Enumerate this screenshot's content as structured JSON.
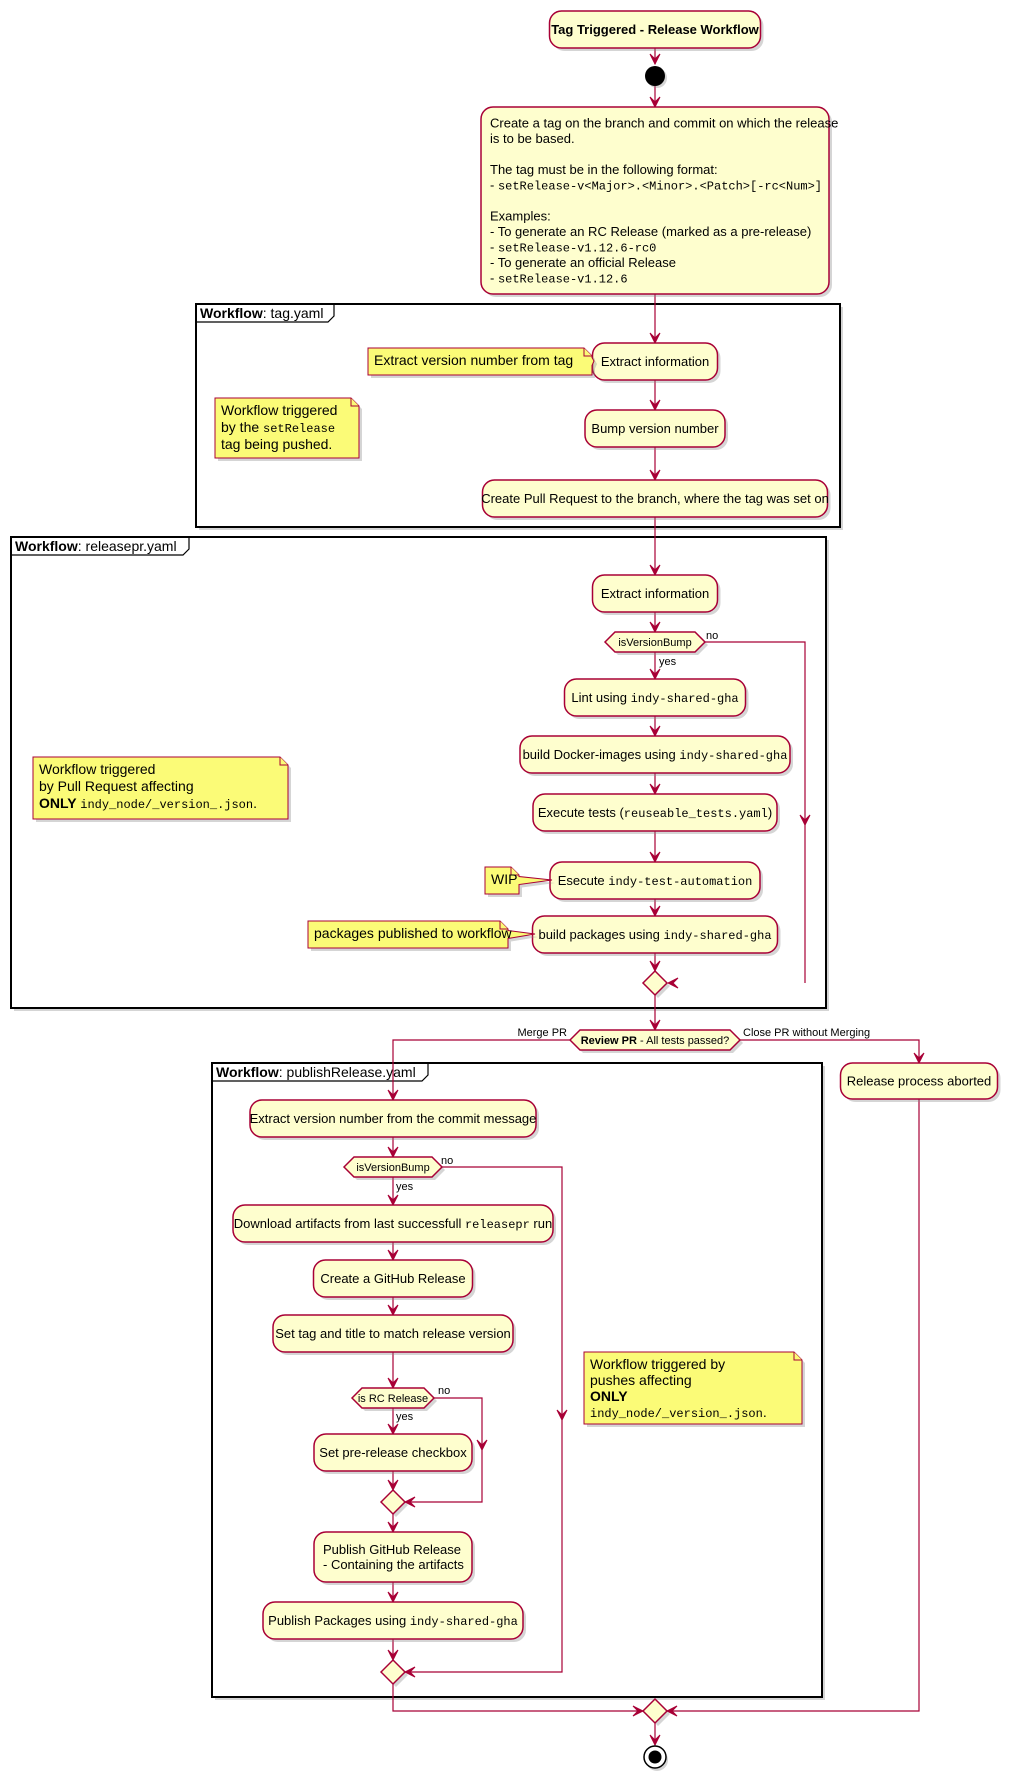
{
  "diagram": {
    "title": "Tag Triggered - Release Workflow",
    "intro": {
      "lines": [
        [
          {
            "t": "Create a tag on the branch and commit on which the release"
          }
        ],
        [
          {
            "t": "is to be based."
          }
        ],
        [],
        [
          {
            "t": "The tag must be in the following format:"
          }
        ],
        [
          {
            "t": " - "
          },
          {
            "t": "setRelease-v<Major>.<Minor>.<Patch>[-rc<Num>]",
            "mono": true
          }
        ],
        [],
        [
          {
            "t": "Examples:"
          }
        ],
        [
          {
            "t": "  - To generate an RC Release (marked as a pre-release)"
          }
        ],
        [
          {
            "t": "  - "
          },
          {
            "t": "setRelease-v1.12.6-rc0",
            "mono": true
          }
        ],
        [
          {
            "t": "  - To generate an official Release"
          }
        ],
        [
          {
            "t": "   - "
          },
          {
            "t": "setRelease-v1.12.6",
            "mono": true
          }
        ]
      ]
    },
    "frames": {
      "tag": {
        "keyword": "Workflow",
        "name": ": tag.yaml"
      },
      "releasepr": {
        "keyword": "Workflow",
        "name": ": releasepr.yaml"
      },
      "publish": {
        "keyword": "Workflow",
        "name": ": publishRelease.yaml"
      }
    },
    "tag_flow": {
      "extract": "Extract information",
      "extract_note": "Extract version number from tag",
      "bump": "Bump version number",
      "create_pr": "Create Pull Request to the branch, where the tag was set on",
      "trigger_note": [
        [
          {
            "t": "Workflow triggered"
          }
        ],
        [
          {
            "t": "by the "
          },
          {
            "t": "setRelease",
            "mono": true
          }
        ],
        [
          {
            "t": "tag being pushed."
          }
        ]
      ]
    },
    "releasepr_flow": {
      "extract": "Extract information",
      "decision": "isVersionBump",
      "yes": "yes",
      "no": "no",
      "lint": [
        {
          "t": "Lint using "
        },
        {
          "t": "indy-shared-gha",
          "mono": true
        }
      ],
      "docker": [
        {
          "t": "build Docker-images using "
        },
        {
          "t": "indy-shared-gha",
          "mono": true
        }
      ],
      "tests": [
        {
          "t": "Execute tests ("
        },
        {
          "t": "reuseable_tests.yaml",
          "mono": true
        },
        {
          "t": ")"
        }
      ],
      "automation": [
        {
          "t": "Esecute "
        },
        {
          "t": "indy-test-automation",
          "mono": true
        }
      ],
      "automation_note": "WIP",
      "packages": [
        {
          "t": "build packages using "
        },
        {
          "t": "indy-shared-gha",
          "mono": true
        }
      ],
      "packages_note": "packages published to workflow",
      "trigger_note": [
        [
          {
            "t": "Workflow triggered"
          }
        ],
        [
          {
            "t": "by Pull Request affecting"
          }
        ],
        [
          {
            "t": "ONLY ",
            "bold": true
          },
          {
            "t": "indy_node/_version_.json",
            "mono": true
          },
          {
            "t": "."
          }
        ]
      ]
    },
    "review": {
      "bold": "Review PR",
      "rest": " - All tests passed?",
      "merge": "Merge PR",
      "close": "Close PR without Merging",
      "aborted": "Release process aborted"
    },
    "publish_flow": {
      "extract": "Extract version number from the commit message",
      "decision": "isVersionBump",
      "yes": "yes",
      "no": "no",
      "download": [
        {
          "t": "Download artifacts from last successfull "
        },
        {
          "t": "releasepr",
          "mono": true
        },
        {
          "t": " run"
        }
      ],
      "create_release": "Create a GitHub Release",
      "set_tag": "Set tag and title to match release version",
      "rc_decision": "is RC Release",
      "rc_yes": "yes",
      "rc_no": "no",
      "prerelease": "Set pre-release checkbox",
      "publish_release": [
        "Publish GitHub Release",
        "  - Containing the artifacts"
      ],
      "publish_packages": [
        {
          "t": "Publish Packages using "
        },
        {
          "t": "indy-shared-gha",
          "mono": true
        }
      ],
      "trigger_note": [
        [
          {
            "t": "Workflow triggered by"
          }
        ],
        [
          {
            "t": "pushes affecting"
          }
        ],
        [
          {
            "t": "ONLY",
            "bold": true
          }
        ],
        [
          {
            "t": "indy_node/_version_.json",
            "mono": true
          },
          {
            "t": "."
          }
        ]
      ]
    },
    "colors": {
      "activity_fill": "#fefece",
      "border": "#a80036",
      "note_fill": "#fbfb77",
      "frame": "#000000"
    }
  }
}
